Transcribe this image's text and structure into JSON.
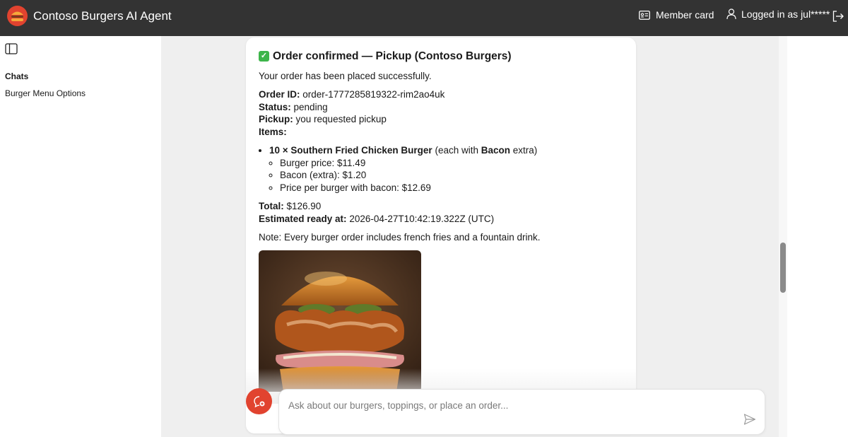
{
  "header": {
    "title": "Contoso Burgers AI Agent",
    "member_card_label": "Member card",
    "login_status": "Logged in as jul*****"
  },
  "sidebar": {
    "chats_heading": "Chats",
    "items": [
      {
        "label": "Burger Menu Options"
      }
    ]
  },
  "message": {
    "title": "Order confirmed — Pickup (Contoso Burgers)",
    "intro": "Your order has been placed successfully.",
    "order_id_label": "Order ID:",
    "order_id": "order-1777285819322-rim2ao4uk",
    "status_label": "Status:",
    "status": "pending",
    "pickup_label": "Pickup:",
    "pickup": "you requested pickup",
    "items_label": "Items:",
    "item": {
      "quantity_name": "10 × Southern Fried Chicken Burger",
      "each_with": "(each with",
      "topping": "Bacon",
      "extra": "extra)",
      "details": [
        "Burger price: $11.49",
        "Bacon (extra): $1.20",
        "Price per burger with bacon: $12.69"
      ]
    },
    "total_label": "Total:",
    "total": "$126.90",
    "ready_label": "Estimated ready at:",
    "ready": "2026-04-27T10:42:19.322Z (UTC)",
    "note": "Note: Every burger order includes french fries and a fountain drink."
  },
  "composer": {
    "placeholder": "Ask about our burgers, toppings, or place an order..."
  },
  "icons": {
    "logo": "burger-logo-icon",
    "member_card": "id-card-icon",
    "user": "user-icon",
    "logout": "logout-icon",
    "sidebar_toggle": "sidebar-toggle-icon",
    "new_chat": "new-chat-icon",
    "send": "send-icon",
    "check": "check-mark-icon"
  },
  "colors": {
    "header_bg": "#333333",
    "accent": "#e1432f",
    "check_green": "#3db54a"
  }
}
